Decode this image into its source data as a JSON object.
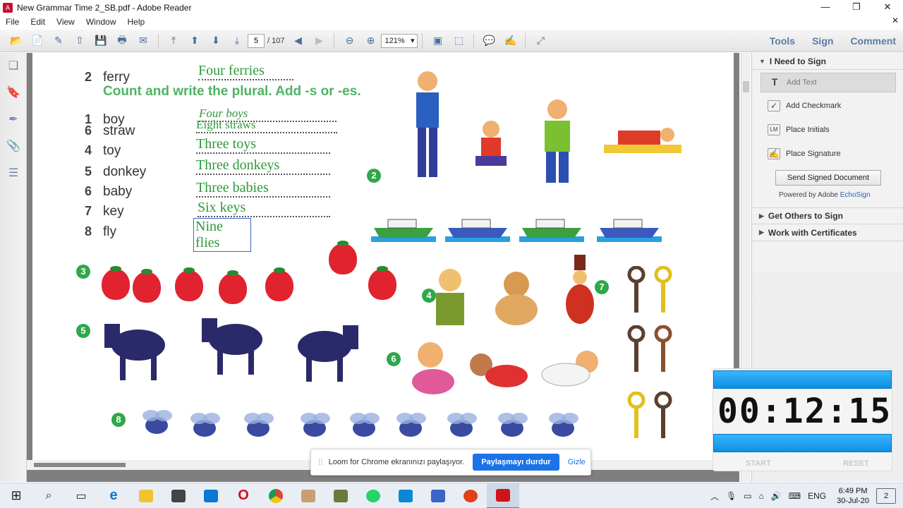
{
  "window": {
    "title": "New Grammar Time 2_SB.pdf - Adobe Reader",
    "minimize": "—",
    "restore": "❐",
    "close": "✕",
    "doc_close": "✕"
  },
  "menu": [
    "File",
    "Edit",
    "View",
    "Window",
    "Help"
  ],
  "toolbar": {
    "page_current": "5",
    "page_total": "/ 107",
    "zoom": "121%",
    "tools": "Tools",
    "sign": "Sign",
    "comment": "Comment"
  },
  "exercise": {
    "heading": "Count and write the plural. Add -s or -es.",
    "rows": [
      {
        "num": "2",
        "word": "ferry",
        "answer": "Four ferries"
      },
      {
        "num": "1",
        "word": "boy",
        "answer": "Four boys"
      },
      {
        "num": "6",
        "word": "straw",
        "answer": "Eight straws"
      },
      {
        "num": "4",
        "word": "toy",
        "answer": "Three toys"
      },
      {
        "num": "5",
        "word": "donkey",
        "answer": "Three donkeys"
      },
      {
        "num": "6",
        "word": "baby",
        "answer": "Three babies"
      },
      {
        "num": "7",
        "word": "key",
        "answer": "Six keys"
      },
      {
        "num": "8",
        "word": "fly",
        "answer": "Nine flies"
      }
    ],
    "picture_labels": [
      "2",
      "3",
      "4",
      "5",
      "6",
      "7",
      "8"
    ]
  },
  "right_panel": {
    "sections": [
      {
        "label": "I Need to Sign",
        "expanded": true
      },
      {
        "label": "Get Others to Sign",
        "expanded": false
      },
      {
        "label": "Work with Certificates",
        "expanded": false
      }
    ],
    "sign_items": [
      "Add Text",
      "Add Checkmark",
      "Place Initials",
      "Place Signature"
    ],
    "send_button": "Send Signed Document",
    "powered_by": "Powered by Adobe",
    "powered_link": "EchoSign"
  },
  "timer": {
    "display": "00:12:15",
    "start": "START",
    "reset": "RESET"
  },
  "loom": {
    "message": "Loom for Chrome ekranınızı paylaşıyor.",
    "stop_button": "Paylaşmayı durdur",
    "hide_link": "Gizle"
  },
  "taskbar": {
    "language": "ENG",
    "time": "6:49 PM",
    "date": "30-Jul-20",
    "notifications": "2"
  },
  "colors": {
    "accent_green": "#2ea84a",
    "tools_blue": "#5b7aa6",
    "loom_blue": "#1a73e8",
    "timer_blue": "#1aa3f2"
  }
}
